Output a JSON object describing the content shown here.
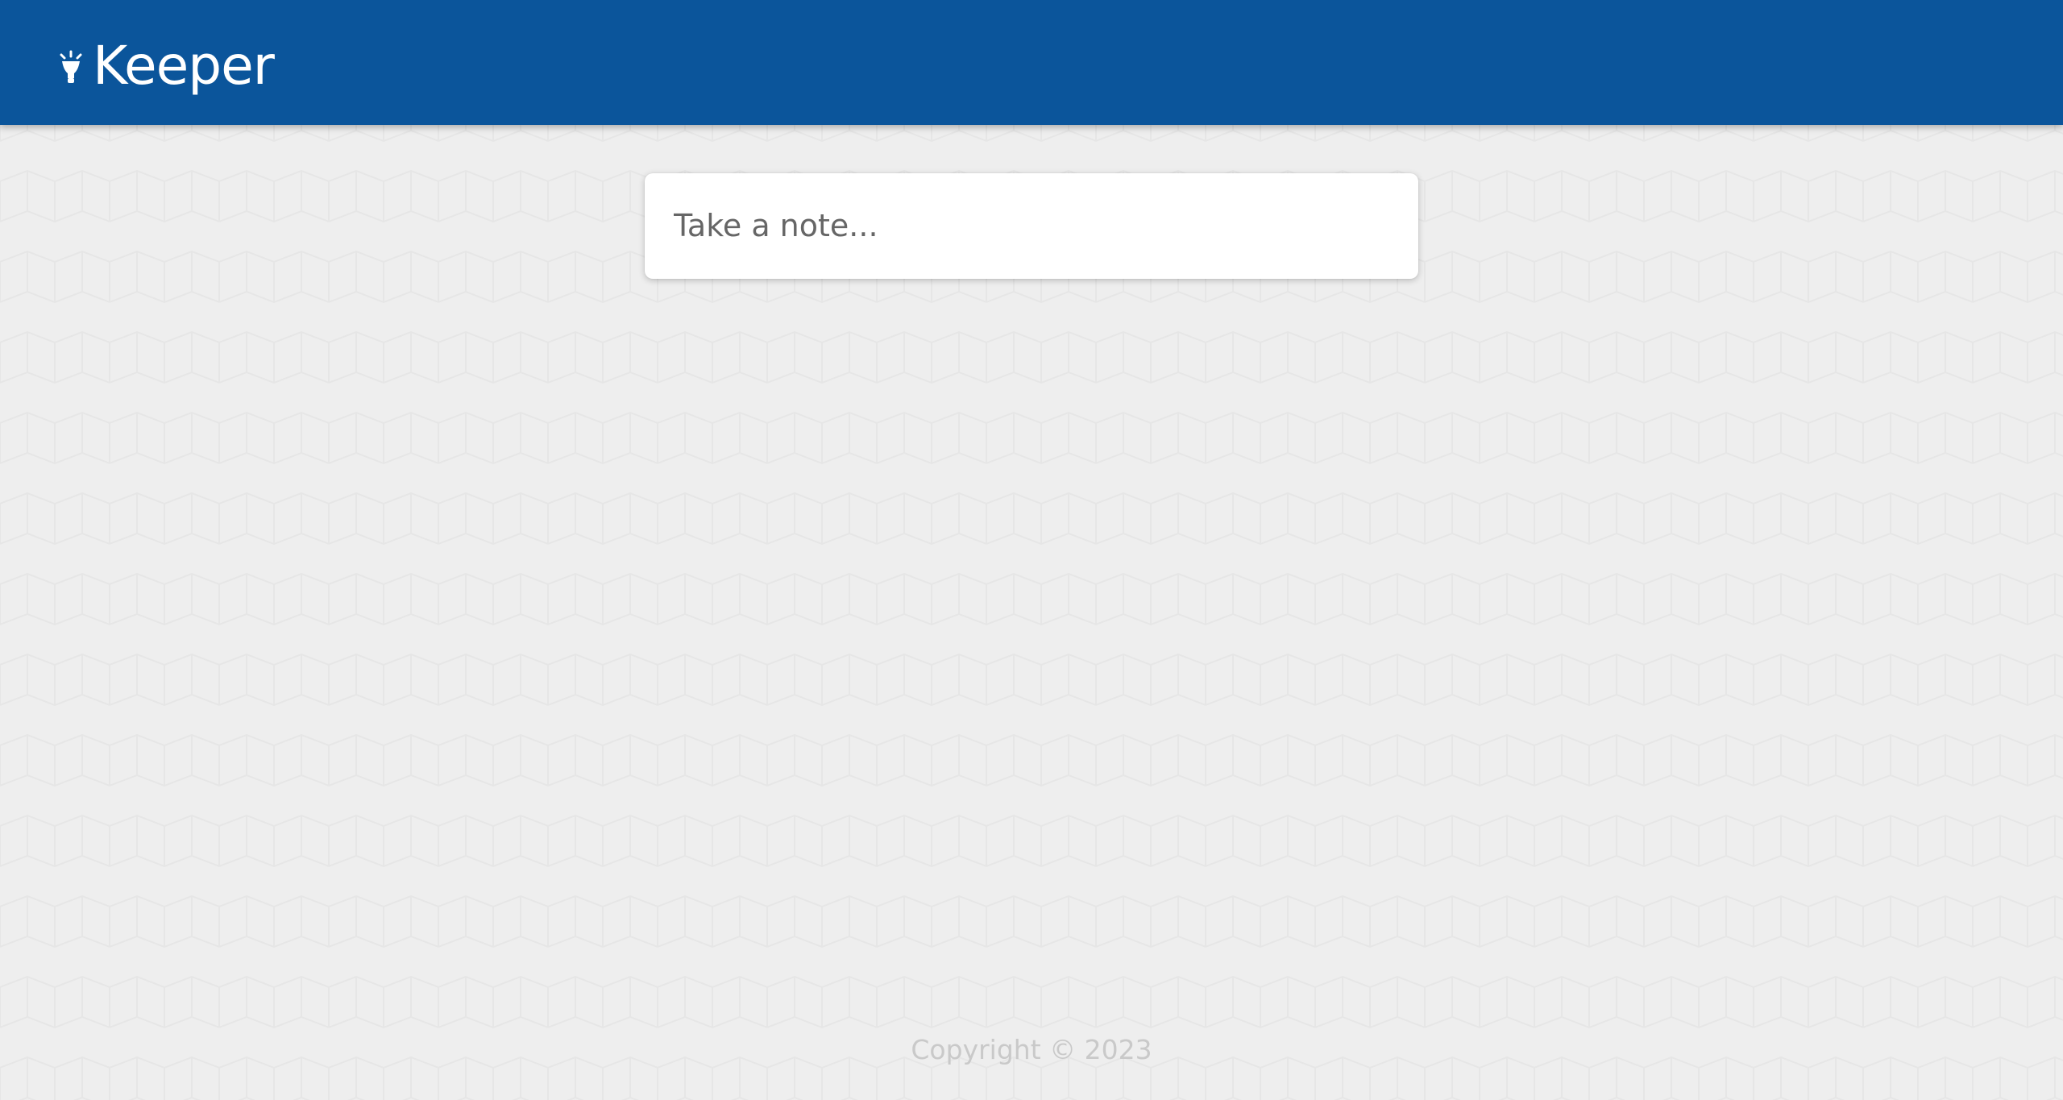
{
  "app": {
    "name": "Keeper",
    "logo_icon": "lamp-icon",
    "brand_color": "#0b559b"
  },
  "composer": {
    "placeholder": "Take a note..."
  },
  "footer": {
    "copyright": "Copyright © 2023"
  },
  "colors": {
    "background": "#eeeeee",
    "pattern": "#e2e2e2",
    "header_text": "#ffffff",
    "footer_text": "#c9c9c9"
  }
}
